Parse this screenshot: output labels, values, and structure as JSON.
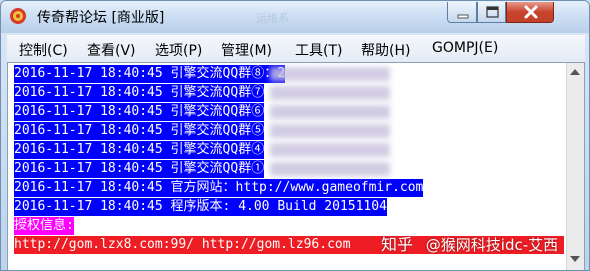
{
  "window": {
    "title": "传奇帮论坛 [商业版]",
    "faded_title": "运维系",
    "controls": {
      "minimize": "minimize-icon",
      "maximize": "maximize-icon",
      "close": "close-icon"
    }
  },
  "menu": [
    "控制(C)",
    "查看(V)",
    "选项(P)",
    "管理(M)",
    "工具(T)",
    "帮助(H)",
    "GOMPJ(E)"
  ],
  "log_lines": [
    {
      "timestamp": "2016-11-17 18:40:45",
      "text": "引擎交流QQ群⑧：2",
      "style": "blue"
    },
    {
      "timestamp": "2016-11-17 18:40:45",
      "text": "引擎交流QQ群⑦",
      "style": "blue"
    },
    {
      "timestamp": "2016-11-17 18:40:45",
      "text": "引擎交流QQ群⑥",
      "style": "blue"
    },
    {
      "timestamp": "2016-11-17 18:40:45",
      "text": "引擎交流QQ群⑤",
      "style": "blue"
    },
    {
      "timestamp": "2016-11-17 18:40:45",
      "text": "引擎交流QQ群④",
      "style": "blue"
    },
    {
      "timestamp": "2016-11-17 18:40:45",
      "text": "引擎交流QQ群①",
      "style": "blue"
    },
    {
      "timestamp": "2016-11-17 18:40:45",
      "text": "官方网站：http://www.gameofmir.com",
      "style": "blue"
    },
    {
      "timestamp": "2016-11-17 18:40:45",
      "text": "程序版本: 4.00 Build 20151104",
      "style": "blue"
    },
    {
      "timestamp": "",
      "text": "授权信息:",
      "style": "magenta"
    },
    {
      "timestamp": "",
      "text": "http://gom.lzx8.com:99/ http://gom.lz96.com",
      "style": "red"
    }
  ],
  "watermark": {
    "site": "知乎",
    "handle": "@猴网科技idc-艾西"
  },
  "colors": {
    "log_blue": "#0000ff",
    "log_magenta": "#ff00ff",
    "log_red": "#ee1d24",
    "close_button": "#c8432d"
  }
}
